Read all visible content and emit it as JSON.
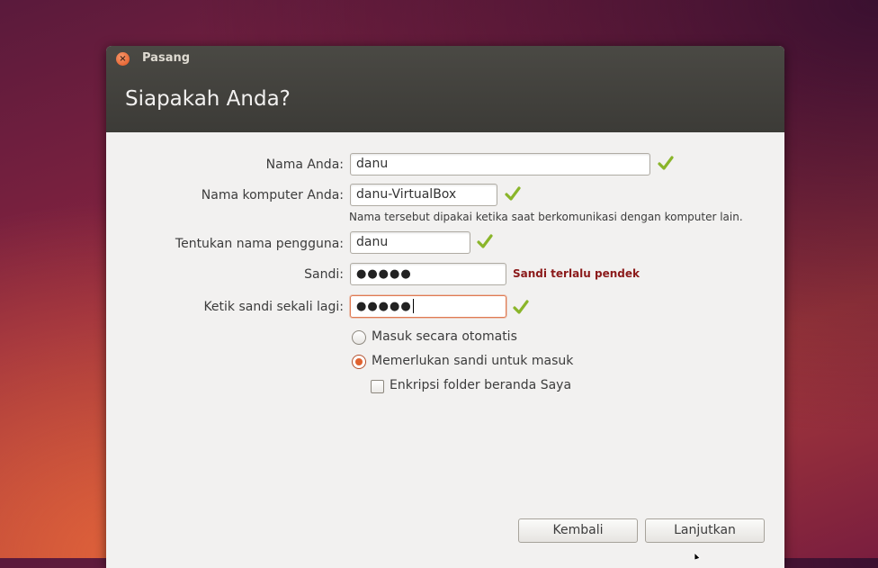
{
  "window": {
    "title": "Pasang",
    "heading": "Siapakah Anda?"
  },
  "form": {
    "name_label": "Nama Anda:",
    "name_value": "danu",
    "computer_label": "Nama komputer Anda:",
    "computer_value": "danu-VirtualBox",
    "computer_hint": "Nama tersebut dipakai ketika saat berkomunikasi dengan komputer lain.",
    "username_label": "Tentukan nama pengguna:",
    "username_value": "danu",
    "password_label": "Sandi:",
    "password_dots": "●●●●●",
    "password_error": "Sandi terlalu pendek",
    "confirm_label": "Ketik sandi sekali lagi:",
    "confirm_dots": "●●●●●"
  },
  "options": {
    "auto_login": "Masuk secara otomatis",
    "require_password": "Memerlukan sandi untuk masuk",
    "encrypt_home": "Enkripsi folder beranda Saya",
    "selected": "require_password",
    "encrypt_checked": false
  },
  "buttons": {
    "back": "Kembali",
    "continue": "Lanjutkan"
  },
  "colors": {
    "accent": "#e0622f",
    "error": "#8b1a1a",
    "check": "#8ab52a"
  }
}
